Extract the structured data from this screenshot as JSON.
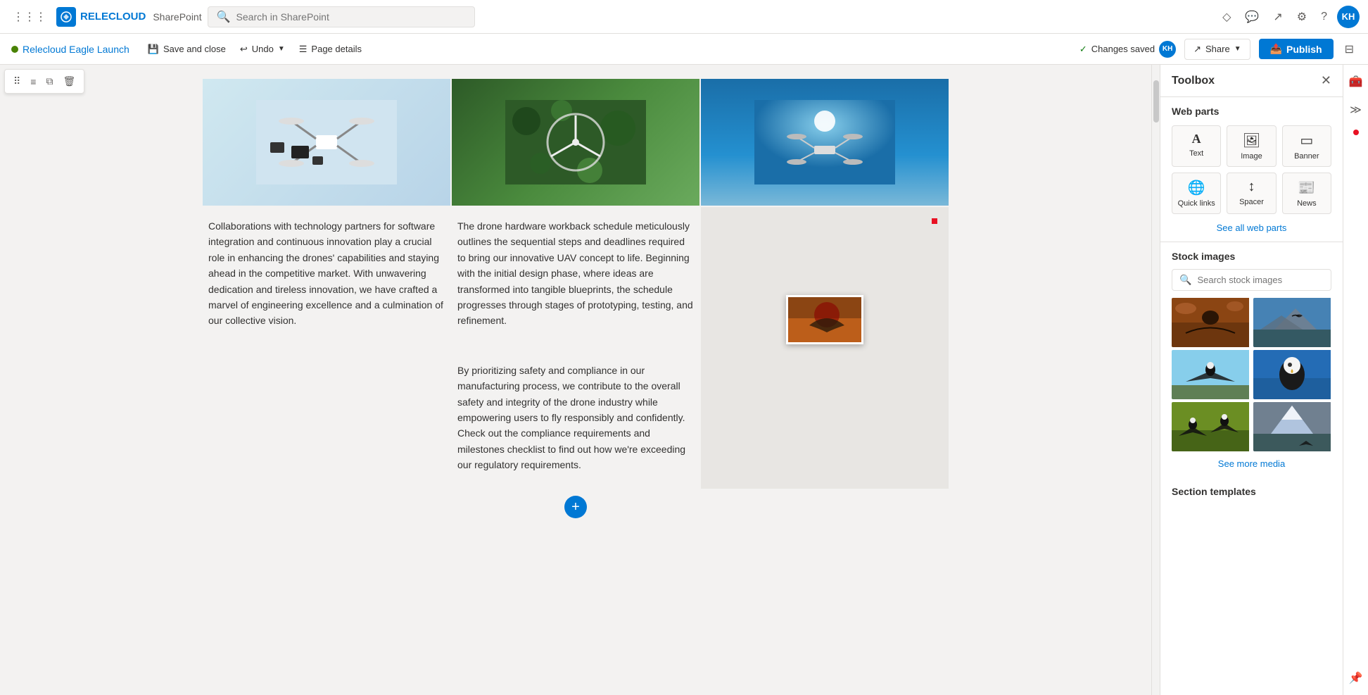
{
  "app": {
    "name": "RELECLOUD",
    "suite": "SharePoint",
    "search_placeholder": "Search in SharePoint"
  },
  "topbar": {
    "icons": [
      "grid-icon",
      "relecloud-icon",
      "sharepoint-icon"
    ],
    "search_placeholder": "Search in SharePoint",
    "right_icons": [
      "community-icon",
      "chat-icon",
      "share-icon",
      "settings-icon",
      "help-icon"
    ],
    "avatar_initials": "KH"
  },
  "secondbar": {
    "site_name": "Relecloud Eagle Launch",
    "save_close_label": "Save and close",
    "undo_label": "Undo",
    "page_details_label": "Page details",
    "changes_saved_label": "Changes saved",
    "share_label": "Share",
    "publish_label": "Publish"
  },
  "content": {
    "col1_text": "Collaborations with technology partners for software integration and continuous innovation play a crucial role in enhancing the drones' capabilities and staying ahead in the competitive market. With unwavering dedication and tireless innovation, we have crafted a marvel of engineering excellence and a culmination of our collective vision.",
    "col2_text1": "The drone hardware workback schedule meticulously outlines the sequential steps and deadlines required to bring our innovative UAV concept to life. Beginning with the initial design phase, where ideas are transformed into tangible blueprints, the schedule progresses through stages of prototyping, testing, and refinement.",
    "col2_text2": "By prioritizing safety and compliance in our manufacturing process, we contribute to the overall safety and integrity of the drone industry while empowering users to fly responsibly and confidently. Check out the compliance requirements and milestones checklist to find out how we're exceeding our regulatory requirements."
  },
  "toolbox": {
    "title": "Toolbox",
    "web_parts_title": "Web parts",
    "web_parts": [
      {
        "id": "text",
        "label": "Text",
        "icon": "T"
      },
      {
        "id": "image",
        "label": "Image",
        "icon": "🖼"
      },
      {
        "id": "banner",
        "label": "Banner",
        "icon": "📋"
      },
      {
        "id": "quick-links",
        "label": "Quick links",
        "icon": "🌐"
      },
      {
        "id": "spacer",
        "label": "Spacer",
        "icon": "↕"
      },
      {
        "id": "news",
        "label": "News",
        "icon": "📰"
      }
    ],
    "see_all_label": "See all web parts",
    "stock_images_title": "Stock images",
    "stock_search_placeholder": "Search stock images",
    "see_more_label": "See more media",
    "section_templates_title": "Section templates"
  },
  "floating_toolbar": {
    "buttons": [
      "move-icon",
      "align-icon",
      "duplicate-icon",
      "delete-icon"
    ]
  }
}
